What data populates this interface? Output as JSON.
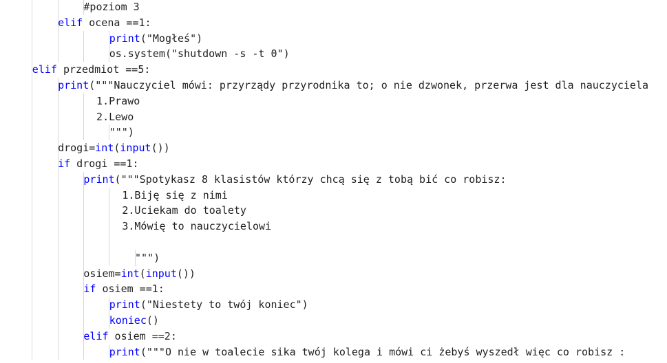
{
  "lines": [
    {
      "indent": 3,
      "text": "#poziom 3",
      "kind": "comment"
    },
    {
      "indent": 2,
      "text": "elif ocena ==1:",
      "kind": "code"
    },
    {
      "indent": 4,
      "text": "print(\"Mogłeś\")",
      "kind": "code"
    },
    {
      "indent": 4,
      "text": "os.system(\"shutdown -s -t 0\")",
      "kind": "code"
    },
    {
      "indent": 1,
      "text": "elif przedmiot ==5:",
      "kind": "code"
    },
    {
      "indent": 2,
      "text": "print(\"\"\"Nauczyciel mówi: przyrządy przyrodnika to; o nie dzwonek, przerwa jest dla nauczyciela",
      "kind": "code"
    },
    {
      "indent": 3.5,
      "text": "1.Prawo",
      "kind": "string"
    },
    {
      "indent": 3.5,
      "text": "2.Lewo",
      "kind": "string"
    },
    {
      "indent": 4,
      "text": "\"\"\")",
      "kind": "string"
    },
    {
      "indent": 2,
      "text": "drogi=int(input())",
      "kind": "code"
    },
    {
      "indent": 2,
      "text": "if drogi ==1:",
      "kind": "code"
    },
    {
      "indent": 3,
      "text": "print(\"\"\"Spotykasz 8 klasistów którzy chcą się z tobą bić co robisz:",
      "kind": "code"
    },
    {
      "indent": 4.5,
      "text": "1.Biję się z nimi",
      "kind": "string"
    },
    {
      "indent": 4.5,
      "text": "2.Uciekam do toalety",
      "kind": "string"
    },
    {
      "indent": 4.5,
      "text": "3.Mówię to nauczycielowi",
      "kind": "string"
    },
    {
      "indent": 4.5,
      "text": "",
      "kind": "string"
    },
    {
      "indent": 5,
      "text": "\"\"\")",
      "kind": "string"
    },
    {
      "indent": 3,
      "text": "osiem=int(input())",
      "kind": "code"
    },
    {
      "indent": 3,
      "text": "if osiem ==1:",
      "kind": "code"
    },
    {
      "indent": 4,
      "text": "print(\"Niestety to twój koniec\")",
      "kind": "code"
    },
    {
      "indent": 4,
      "text": "koniec()",
      "kind": "code"
    },
    {
      "indent": 3,
      "text": "elif osiem ==2:",
      "kind": "code"
    },
    {
      "indent": 4,
      "text": "print(\"\"\"O nie w toalecie sika twój kolega i mówi ci żebyś wyszedł więc co robisz :",
      "kind": "code"
    }
  ]
}
